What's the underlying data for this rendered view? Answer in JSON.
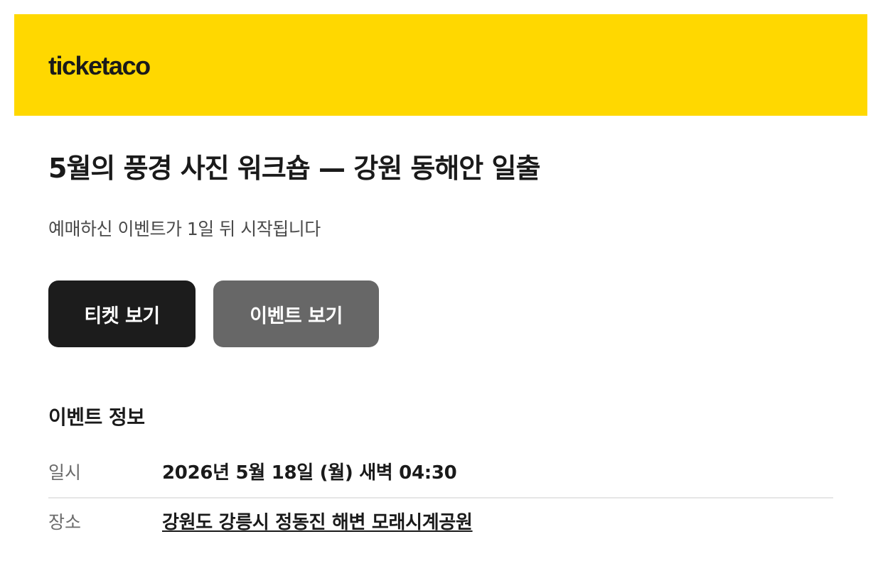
{
  "brand": {
    "logo_text": "ticketaco",
    "header_color": "#FFD800"
  },
  "event": {
    "title": "5월의 풍경 사진 워크숍 — 강원 동해안 일출",
    "status_message": "예매하신 이벤트가 1일 뒤 시작됩니다"
  },
  "actions": {
    "view_ticket_label": "티켓 보기",
    "view_event_label": "이벤트 보기"
  },
  "event_info": {
    "section_title": "이벤트 정보",
    "rows": [
      {
        "label": "일시",
        "value": "2026년 5월 18일 (월) 새벽 04:30"
      },
      {
        "label": "장소",
        "value": "강원도 강릉시 정동진 해변 모래시계공원"
      }
    ]
  },
  "colors": {
    "primary_button": "#1c1c1c",
    "secondary_button": "#676767",
    "divider": "#e6e6e6"
  }
}
